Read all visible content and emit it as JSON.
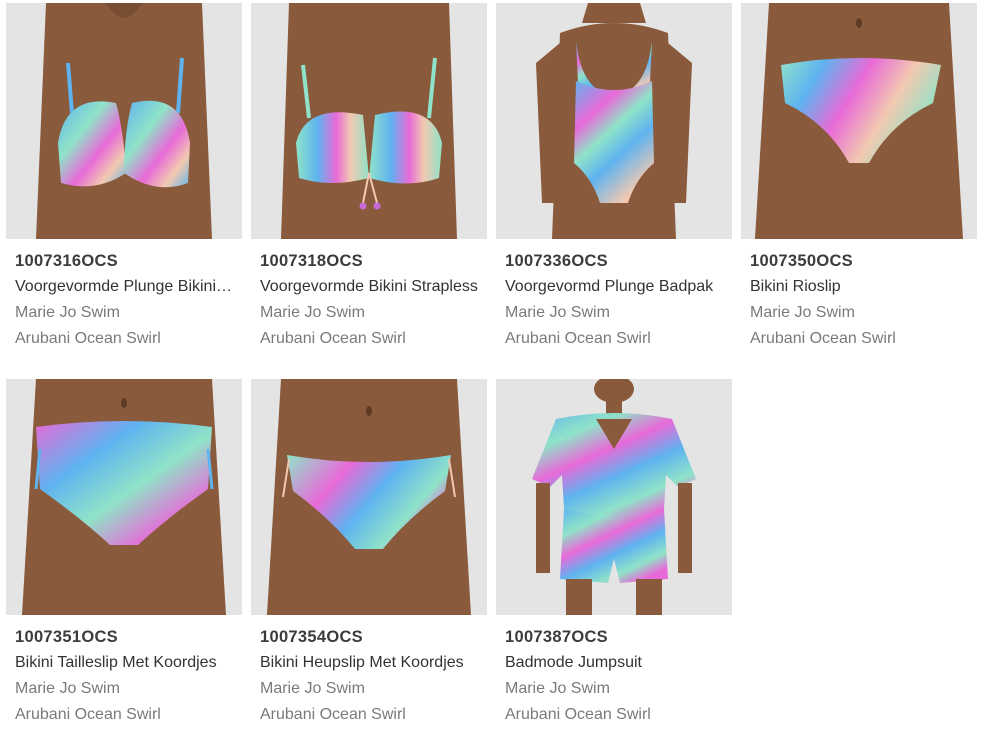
{
  "products": [
    {
      "sku": "1007316OCS",
      "name": "Voorgevormde Plunge Bikini Top",
      "brand": "Marie Jo Swim",
      "color": "Arubani Ocean Swirl",
      "image_icon": "bikini-top-photo"
    },
    {
      "sku": "1007318OCS",
      "name": "Voorgevormde Bikini Strapless",
      "brand": "Marie Jo Swim",
      "color": "Arubani Ocean Swirl",
      "image_icon": "strapless-bikini-photo"
    },
    {
      "sku": "1007336OCS",
      "name": "Voorgevormd Plunge Badpak",
      "brand": "Marie Jo Swim",
      "color": "Arubani Ocean Swirl",
      "image_icon": "swimsuit-photo"
    },
    {
      "sku": "1007350OCS",
      "name": "Bikini Rioslip",
      "brand": "Marie Jo Swim",
      "color": "Arubani Ocean Swirl",
      "image_icon": "rioslip-photo"
    },
    {
      "sku": "1007351OCS",
      "name": "Bikini Tailleslip Met Koordjes",
      "brand": "Marie Jo Swim",
      "color": "Arubani Ocean Swirl",
      "image_icon": "tailleslip-photo"
    },
    {
      "sku": "1007354OCS",
      "name": "Bikini Heupslip Met Koordjes",
      "brand": "Marie Jo Swim",
      "color": "Arubani Ocean Swirl",
      "image_icon": "heupslip-photo"
    },
    {
      "sku": "1007387OCS",
      "name": "Badmode Jumpsuit",
      "brand": "Marie Jo Swim",
      "color": "Arubani Ocean Swirl",
      "image_icon": "jumpsuit-photo"
    }
  ],
  "colors": {
    "image_bg": "#e4e4e4",
    "skin": "#8a5a3c",
    "print_blue": "#5fb3f0",
    "print_pink": "#e86ad8",
    "print_mint": "#8fe3c8",
    "sku_text": "#3c3c3c",
    "name_text": "#333333",
    "muted_text": "#7a7a7a"
  }
}
